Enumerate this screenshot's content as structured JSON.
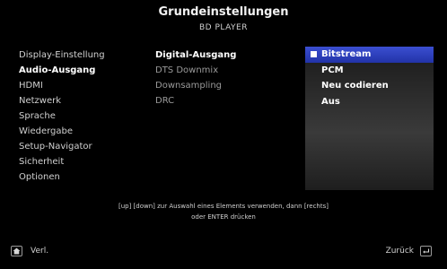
{
  "header": {
    "title": "Grundeinstellungen",
    "subtitle": "BD PLAYER"
  },
  "menu": {
    "items": [
      {
        "label": "Display-Einstellung"
      },
      {
        "label": "Audio-Ausgang"
      },
      {
        "label": "HDMI"
      },
      {
        "label": "Netzwerk"
      },
      {
        "label": "Sprache"
      },
      {
        "label": "Wiedergabe"
      },
      {
        "label": "Setup-Navigator"
      },
      {
        "label": "Sicherheit"
      },
      {
        "label": "Optionen"
      }
    ],
    "active_index": 1
  },
  "submenu": {
    "items": [
      {
        "label": "Digital-Ausgang"
      },
      {
        "label": "DTS Downmix"
      },
      {
        "label": "Downsampling"
      },
      {
        "label": "DRC"
      }
    ],
    "active_index": 0
  },
  "options": {
    "items": [
      {
        "label": "Bitstream"
      },
      {
        "label": "PCM"
      },
      {
        "label": "Neu codieren"
      },
      {
        "label": "Aus"
      }
    ],
    "selected_index": 0
  },
  "hint": {
    "line1": "[up] [down] zur Auswahl eines Elements verwenden, dann [rechts]",
    "line2": "oder ENTER drücken"
  },
  "footer": {
    "left_label": "Verl.",
    "left_icon": "home-icon",
    "right_label": "Zurück",
    "right_icon": "return-icon"
  },
  "colors": {
    "background": "#000000",
    "selection": "#2f43c4"
  }
}
